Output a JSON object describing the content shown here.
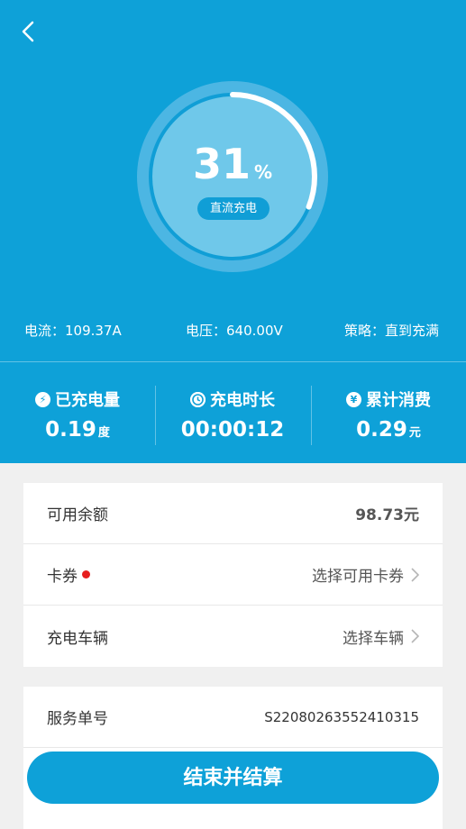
{
  "charge": {
    "percent": "31",
    "percent_value": 31,
    "percent_symbol": "%",
    "mode": "直流充电"
  },
  "stats": {
    "current": "电流：109.37A",
    "voltage": "电压：640.00V",
    "strategy": "策略：直到充满"
  },
  "summary": [
    {
      "icon": "lightning-icon",
      "label": "已充电量",
      "value": "0.19",
      "unit": "度"
    },
    {
      "icon": "clock-icon",
      "label": "充电时长",
      "value": "00:00:12",
      "unit": ""
    },
    {
      "icon": "yen-icon",
      "label": "累计消费",
      "value": "0.29",
      "unit": "元"
    }
  ],
  "account": {
    "balance_label": "可用余额",
    "balance_value": "98.73元",
    "coupon_label": "卡券",
    "coupon_value": "选择可用卡券",
    "vehicle_label": "充电车辆",
    "vehicle_value": "选择车辆"
  },
  "order": {
    "service_no_label": "服务单号",
    "service_no_value": "S22080263552410315"
  },
  "button": {
    "end_settle_label": "结束并结算"
  },
  "colors": {
    "primary": "#0ea1d8",
    "ring_inner": "#6fc8ea",
    "badge_dot": "#e61e1e"
  }
}
